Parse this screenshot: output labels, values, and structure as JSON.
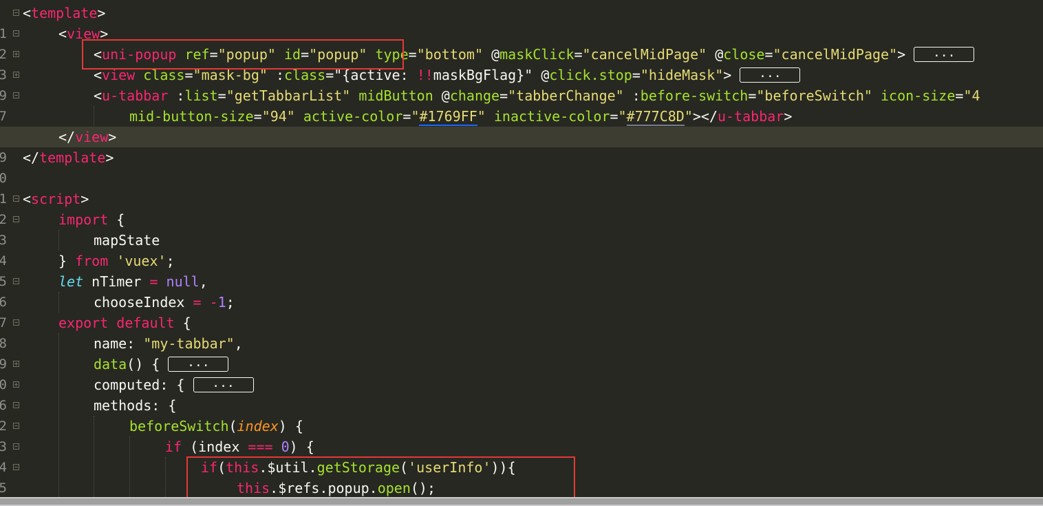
{
  "editor": {
    "theme": "monokai",
    "colors": {
      "background": "#272822",
      "tag": "#F92672",
      "attribute": "#A6E22E",
      "string": "#E6DB74",
      "storage": "#66D9EF",
      "constant": "#AE81FF",
      "parameter": "#FD971F",
      "highlight_box": "#E53935"
    },
    "fold_placeholder": "...",
    "lines": [
      {
        "num": "1",
        "fold": "minus"
      },
      {
        "num": "2",
        "fold": "minus"
      },
      {
        "num": "3",
        "fold": "plus"
      },
      {
        "num": "9",
        "fold": "plus"
      },
      {
        "num": "7",
        "fold": "minus"
      },
      {
        "num": "8",
        "fold": ""
      },
      {
        "num": "9",
        "fold": "",
        "current": true
      },
      {
        "num": "0",
        "fold": ""
      },
      {
        "num": "1",
        "fold": ""
      },
      {
        "num": "2",
        "fold": "minus"
      },
      {
        "num": "3",
        "fold": "minus"
      },
      {
        "num": "4",
        "fold": ""
      },
      {
        "num": "5",
        "fold": ""
      },
      {
        "num": "6",
        "fold": "minus"
      },
      {
        "num": "7",
        "fold": ""
      },
      {
        "num": "8",
        "fold": "minus"
      },
      {
        "num": "9",
        "fold": ""
      },
      {
        "num": "0",
        "fold": "plus"
      },
      {
        "num": "6",
        "fold": "plus"
      },
      {
        "num": "2",
        "fold": "minus"
      },
      {
        "num": "3",
        "fold": "minus"
      },
      {
        "num": "4",
        "fold": "minus"
      },
      {
        "num": "5",
        "fold": "minus"
      },
      {
        "num": "6",
        "fold": ""
      }
    ],
    "code": {
      "l1": {
        "open": "<",
        "tag": "template",
        "close": ">"
      },
      "l2": {
        "open": "<",
        "tag": "view",
        "close": ">"
      },
      "l3": {
        "open": "<",
        "tag": "uni-popup",
        "attr1": "ref",
        "eq1": "=",
        "val1": "\"popup\"",
        "attr2": "id",
        "eq2": "=",
        "val2": "\"popup\"",
        "attr3": "type",
        "eq3": "=",
        "val3": "\"bottom\"",
        "attr4a": "@",
        "attr4b": "maskClick",
        "eq4": "=",
        "val4": "\"cancelMidPage\"",
        "attr5a": "@",
        "attr5b": "close",
        "eq5": "=",
        "val5": "\"cancelMidPage\"",
        "close": ">"
      },
      "l4": {
        "open": "<",
        "tag": "view",
        "attr1": "class",
        "eq1": "=",
        "val1": "\"mask-bg\"",
        "attr2a": ":",
        "attr2b": "class",
        "eq2": "=",
        "val2a": "\"{active: ",
        "val2b": "!!",
        "val2c": "maskBgFlag}\"",
        "attr3a": "@",
        "attr3b": "click",
        "attr3c": ".stop",
        "eq3": "=",
        "val3": "\"hideMask\"",
        "close": ">"
      },
      "l5": {
        "open": "<",
        "tag": "u-tabbar",
        "attr1a": ":",
        "attr1b": "list",
        "eq1": "=",
        "val1": "\"getTabbarList\"",
        "attr2": "midButton",
        "attr3a": "@",
        "attr3b": "change",
        "eq3": "=",
        "val3": "\"tabberChange\"",
        "attr4a": ":",
        "attr4b": "before-switch",
        "eq4": "=",
        "val4": "\"beforeSwitch\"",
        "attr5": "icon-size",
        "eq5": "=",
        "val5": "\"4"
      },
      "l6": {
        "attr1": "mid-button-size",
        "eq1": "=",
        "val1": "\"94\"",
        "attr2": "active-color",
        "eq2": "=",
        "q2a": "\"",
        "val2": "#1769FF",
        "q2b": "\"",
        "attr3": "inactive-color",
        "eq3": "=",
        "q3a": "\"",
        "val3": "#777C8D",
        "q3b": "\"",
        "close1": "></",
        "tag": "u-tabbar",
        "close2": ">"
      },
      "l7": {
        "open": "</",
        "tag": "view",
        "close": ">"
      },
      "l8": {
        "open": "</",
        "tag": "template",
        "close": ">"
      },
      "l10": {
        "open": "<",
        "tag": "script",
        "close": ">"
      },
      "l11": {
        "kw": "import",
        "rest": " {"
      },
      "l12": {
        "text": "mapState"
      },
      "l13": {
        "brace": "} ",
        "kw": "from",
        "sp": " ",
        "str": "'vuex'",
        "semi": ";"
      },
      "l14": {
        "kw": "let",
        "id": " nTimer ",
        "op": "=",
        "sp": " ",
        "val": "null",
        "comma": ","
      },
      "l15": {
        "id": "chooseIndex ",
        "op": "=",
        "sp": " ",
        "op2": "-",
        "num": "1",
        "semi": ";"
      },
      "l16": {
        "kw1": "export",
        "sp": " ",
        "kw2": "default",
        "rest": " {"
      },
      "l17": {
        "key": "name: ",
        "str": "\"my-tabbar\"",
        "comma": ","
      },
      "l18": {
        "fn": "data",
        "rest": "() { "
      },
      "l19": {
        "key": "computed: { "
      },
      "l20": {
        "key": "methods: {"
      },
      "l21": {
        "fn": "beforeSwitch",
        "p1": "(",
        "param": "index",
        "p2": ") {"
      },
      "l22": {
        "kw": "if",
        "rest1": " (index ",
        "op": "===",
        "sp": " ",
        "num": "0",
        "rest2": ") {"
      },
      "l23": {
        "kw": "if",
        "p1": "(",
        "this": "this",
        "dot": ".$util.",
        "fn": "getStorage",
        "p2": "(",
        "str": "'userInfo'",
        "p3": ")){"
      },
      "l24": {
        "this": "this",
        "dot": ".$refs.popup.",
        "fn": "open",
        "p": "();"
      }
    }
  }
}
